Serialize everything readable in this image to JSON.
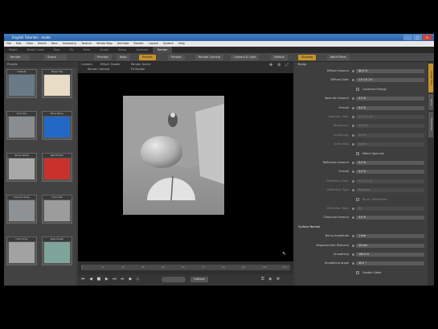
{
  "window": {
    "title": "English Tutorials - modo",
    "buttons": [
      "–",
      "□",
      "✕"
    ]
  },
  "menu": [
    "File",
    "Edit",
    "View",
    "Select",
    "Item",
    "Geometry",
    "Texture",
    "Vertex Map",
    "Animate",
    "Render",
    "Layout",
    "System",
    "Help"
  ],
  "tabs": {
    "items": [
      "Model",
      "Model Quad",
      "Topo",
      "UV",
      "Paint",
      "Sculpt",
      "Setup",
      "Animate",
      "Render"
    ],
    "active_index": 8
  },
  "toolbar": {
    "left": [
      "Render",
      "Scene"
    ],
    "center": [
      "Preview",
      "Bake",
      "Presets",
      "Presets",
      "Turntable"
    ],
    "render_camera": "Render Camera",
    "camera_opt": "Camera & Light",
    "default": "Default",
    "shading": "Shading",
    "work_plane": "Work Plane"
  },
  "left_panel": {
    "header": "Presets",
    "thumbs": [
      {
        "label": "Default",
        "color": "#6a7a86"
      },
      {
        "label": "Metal Tile",
        "color": "#e8dcc6"
      },
      {
        "label": "Dull Tile",
        "color": "#8a8d8f"
      },
      {
        "label": "Blue Shiny",
        "color": "#2468c6"
      },
      {
        "label": "Gloss White",
        "color": "#a9a9a9"
      },
      {
        "label": "Red Plastic",
        "color": "#c8322a"
      },
      {
        "label": "Cement Gray",
        "color": "#8f9294"
      },
      {
        "label": "Concrete",
        "color": "#9c9c9c"
      },
      {
        "label": "Cork Gray",
        "color": "#a2a2a2"
      },
      {
        "label": "Jade Green",
        "color": "#7fa59a"
      }
    ]
  },
  "viewport": {
    "header_items": [
      "Camera",
      "Effect: Shader",
      "Render Scene"
    ],
    "sub_items": [
      "Render Camera",
      "Fit Render"
    ]
  },
  "timeline": {
    "ticks": [
      "0",
      "12",
      "24",
      "36",
      "48",
      "60",
      "72",
      "84",
      "96",
      "108",
      "120"
    ]
  },
  "transport": {
    "speed": "Options"
  },
  "properties": {
    "header": "Bump",
    "rows": [
      {
        "label": "Diffuse Amount",
        "value": "80.0 %",
        "dim": false
      },
      {
        "label": "Diffuse Color",
        "value": "1.0     1.0     1.0",
        "dim": false
      },
      {
        "label": "Conserve Energy",
        "value": "",
        "dim": false,
        "checkbox": true
      },
      {
        "label": "Specular Amount",
        "value": "4.0 %",
        "dim": false
      },
      {
        "label": "Fresnel",
        "value": "0.0 %",
        "dim": false
      },
      {
        "label": "Specular Color",
        "value": "1.0     1.0     1.0",
        "dim": true
      },
      {
        "label": "Roughness",
        "value": "40.0 %",
        "dim": true
      },
      {
        "label": "Anisotropy",
        "value": "0.0 %",
        "dim": true
      },
      {
        "label": "Aniso Map",
        "value": "(none)",
        "dim": true
      },
      {
        "label": "Match Specular",
        "value": "",
        "dim": false,
        "checkbox": true
      },
      {
        "label": "Reflection Amount",
        "value": "0.0 %",
        "dim": false
      },
      {
        "label": "Fresnel",
        "value": "0.0 %",
        "dim": false
      },
      {
        "label": "Reflection Color",
        "value": "1.0     1.0     1.0",
        "dim": true
      },
      {
        "label": "Reflection Type",
        "value": "Raytrace",
        "dim": true
      },
      {
        "label": "Blurry Reflections",
        "value": "",
        "dim": true,
        "checkbox": true
      },
      {
        "label": "Reflection Rays",
        "value": "64",
        "dim": true
      },
      {
        "label": "Clearcoat Amount",
        "value": "0.0 %",
        "dim": false
      },
      {
        "label": "Surface Normal",
        "value": "",
        "dim": false,
        "section": true
      },
      {
        "label": "Bump Amplitude",
        "value": "1 mm",
        "dim": false
      },
      {
        "label": "Displacement Distance",
        "value": "20 mm",
        "dim": false
      },
      {
        "label": "Smoothing",
        "value": "100.0 %",
        "dim": false
      },
      {
        "label": "Smoothing Angle",
        "value": "40.0 °",
        "dim": false
      },
      {
        "label": "Double Sided",
        "value": "",
        "dim": false,
        "checkbox": true
      }
    ]
  },
  "right_tabs": [
    "Shader Tree",
    "Items",
    "Properties"
  ]
}
